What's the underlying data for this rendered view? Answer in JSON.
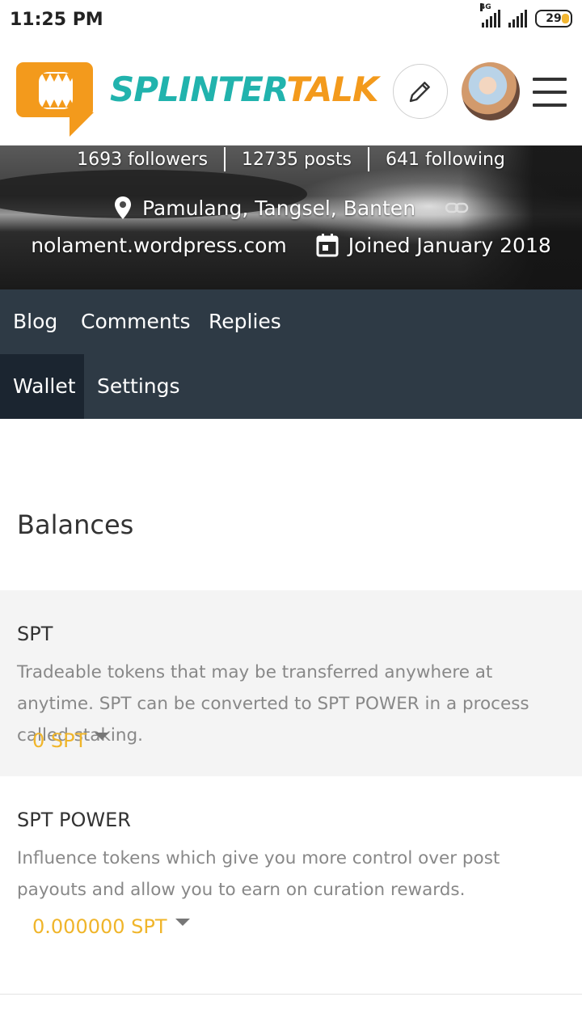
{
  "status_bar": {
    "time": "11:25 PM",
    "network": "4G",
    "battery": "29"
  },
  "header": {
    "brand_part1": "SPLINTER",
    "brand_part2": "TALK"
  },
  "profile": {
    "followers": "1693 followers",
    "posts": "12735 posts",
    "following": "641 following",
    "location": "Pamulang, Tangsel, Banten",
    "website": "nolament.wordpress.com",
    "joined": "Joined January 2018"
  },
  "tabs": [
    {
      "label": "Blog"
    },
    {
      "label": "Comments"
    },
    {
      "label": "Replies"
    },
    {
      "label": "Wallet"
    },
    {
      "label": "Settings"
    }
  ],
  "wallet": {
    "title": "Balances",
    "spt": {
      "name": "SPT",
      "description": "Tradeable tokens that may be transferred anywhere at anytime. SPT can be converted to SPT POWER in a process called staking.",
      "amount": "0 SPT"
    },
    "spt_power": {
      "name": "SPT POWER",
      "description": "Influence tokens which give you more control over post payouts and allow you to earn on curation rewards.",
      "amount": "0.000000 SPT"
    }
  },
  "colors": {
    "brand_teal": "#21b3ad",
    "brand_orange": "#f39a1c",
    "tab_bg": "#2e3a45",
    "amount": "#f0b52a"
  },
  "icons": [
    "pencil-icon",
    "menu-icon",
    "location-pin-icon",
    "link-icon",
    "calendar-icon",
    "caret-down-icon"
  ]
}
